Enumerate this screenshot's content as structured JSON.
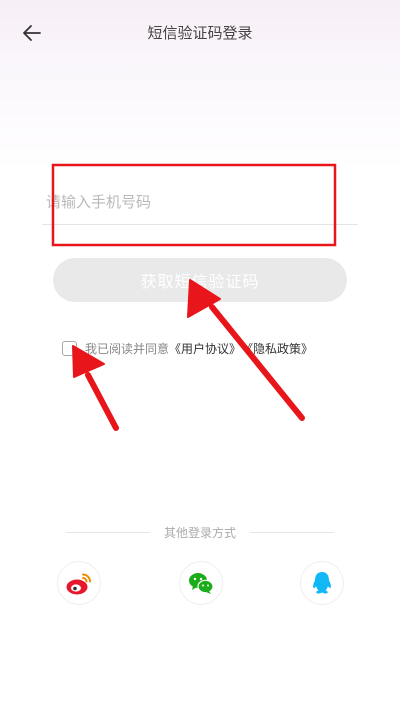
{
  "header": {
    "title": "短信验证码登录",
    "back_icon": "arrow-left-icon"
  },
  "form": {
    "phone_placeholder": "请输入手机号码",
    "get_code_label": "获取短信验证码"
  },
  "agreement": {
    "text": "我已阅读并同意",
    "user_agreement": "《用户协议》",
    "privacy_policy": "《隐私政策》"
  },
  "other_login": {
    "label": "其他登录方式",
    "providers": [
      {
        "name": "weibo",
        "icon": "weibo-icon",
        "color": "#e6162d"
      },
      {
        "name": "wechat",
        "icon": "wechat-icon",
        "color": "#1aad19"
      },
      {
        "name": "qq",
        "icon": "qq-icon",
        "color": "#12b7f5"
      }
    ]
  },
  "colors": {
    "annotation": "#e8161a",
    "button_disabled": "#e9e9e9"
  }
}
